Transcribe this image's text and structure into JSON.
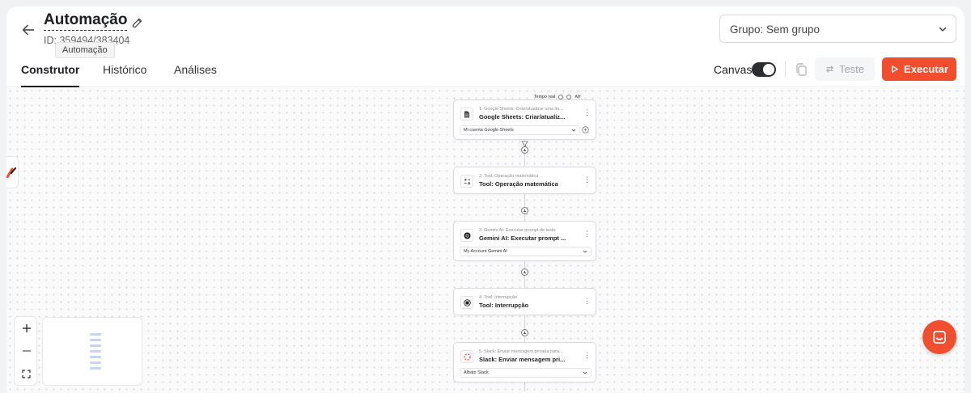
{
  "header": {
    "title": "Automação",
    "id_text": "ID: 359494/383404",
    "tooltip": "Automação",
    "group_select": "Grupo: Sem grupo"
  },
  "tabs": [
    {
      "label": "Construtor",
      "active": true
    },
    {
      "label": "Histórico",
      "active": false
    },
    {
      "label": "Análises",
      "active": false
    }
  ],
  "toolbar": {
    "canvas_label": "Canvas",
    "canvas_on": true,
    "test_label": "Teste",
    "run_label": "Executar"
  },
  "realtime": {
    "label": "Tempo real",
    "initials": "AH"
  },
  "nodes": [
    {
      "subtitle": "1. Google Sheets: Criar/atualizar uma lin...",
      "name": "Google Sheets: Criar/atualiz...",
      "account": "Mi cuenta Google Sheets",
      "icon": "spreadsheet-icon"
    },
    {
      "subtitle": "2. Tool: Operação matemática",
      "name": "Tool: Operação matemática",
      "account": "",
      "icon": "math-icon"
    },
    {
      "subtitle": "3. Gemini AI: Executar prompt de texto",
      "name": "Gemini AI: Executar prompt ...",
      "account": "My Account Gemini AI",
      "icon": "gemini-icon"
    },
    {
      "subtitle": "4. Tool: Interrupção",
      "name": "Tool: Interrupção",
      "account": "",
      "icon": "interrupt-icon"
    },
    {
      "subtitle": "5. Slack: Enviar mensagem privada para...",
      "name": "Slack: Enviar mensagem pri...",
      "account": "Albato Slack",
      "icon": "slack-icon"
    }
  ],
  "colors": {
    "accent": "#f04e2f",
    "dark": "#1b1d21"
  }
}
